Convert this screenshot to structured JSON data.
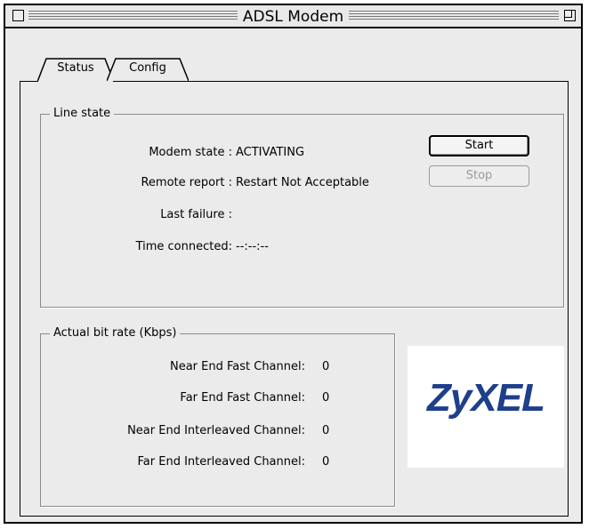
{
  "window": {
    "title": "ADSL Modem"
  },
  "tabs": [
    {
      "label": "Status",
      "active": true
    },
    {
      "label": "Config",
      "active": false
    }
  ],
  "line_state": {
    "title": "Line state",
    "rows": [
      {
        "label": "Modem state",
        "value": "ACTIVATING"
      },
      {
        "label": "Remote report",
        "value": "Restart Not Acceptable"
      },
      {
        "label": "Last failure",
        "value": ""
      },
      {
        "label": "Time connected",
        "value": "--:--:--"
      }
    ],
    "separator": ":",
    "start_label": "Start",
    "stop_label": "Stop"
  },
  "bit_rate": {
    "title": "Actual bit rate (Kbps)",
    "rows": [
      {
        "label": "Near End Fast Channel:",
        "value": "0"
      },
      {
        "label": "Far End Fast Channel:",
        "value": "0"
      },
      {
        "label": "Near End Interleaved Channel:",
        "value": "0"
      },
      {
        "label": "Far End Interleaved Channel:",
        "value": "0"
      }
    ]
  },
  "logo": {
    "text": "ZyXEL",
    "color": "#1d3f8c"
  },
  "colors": {
    "background": "#ebebeb",
    "disabled_text": "#9a9a9a"
  }
}
